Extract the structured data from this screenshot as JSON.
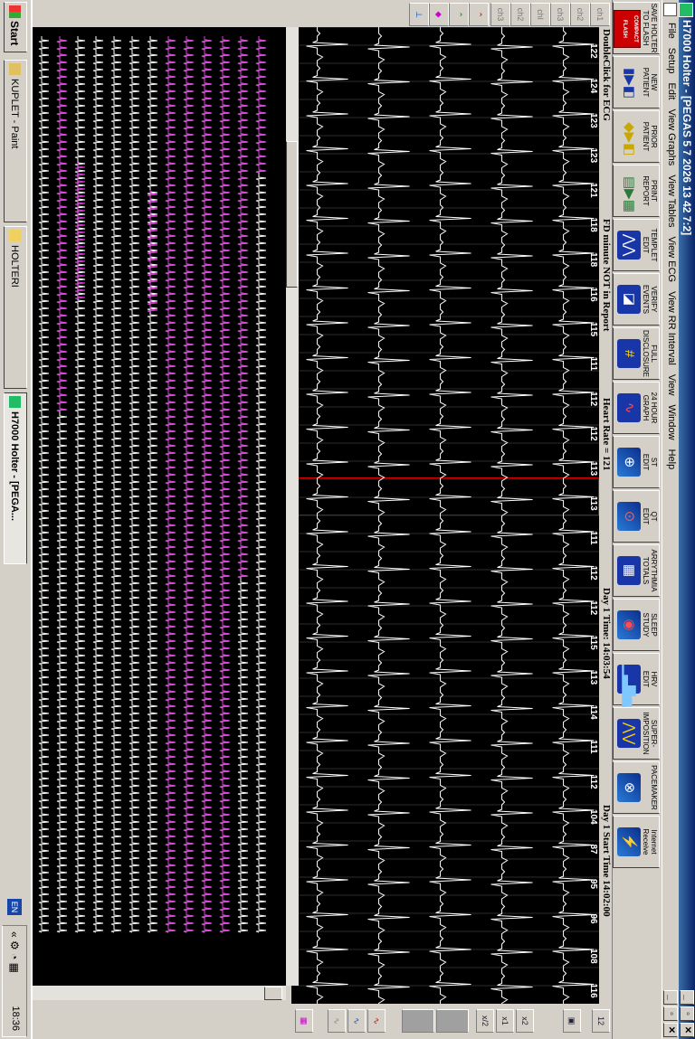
{
  "window": {
    "title": "H7000 Holter - [PEGAS 5 7 2026  13 42 7:2]",
    "min_label": "_",
    "max_label": "▫",
    "close_label": "✕"
  },
  "menu": [
    "File",
    "Setup",
    "Edit",
    "View Graphs",
    "View Tables",
    "View ECG",
    "View RR Interval",
    "View",
    "Window",
    "Help"
  ],
  "toolbar": [
    {
      "label": "SAVE HOLTER\nTO FLASH",
      "icon": "flash-card-icon"
    },
    {
      "label": "NEW\nPATIENT",
      "icon": "new-patient-icon"
    },
    {
      "label": "PRIOR\nPATIENT",
      "icon": "prior-patient-icon"
    },
    {
      "label": "PRINT\nREPORT",
      "icon": "printer-icon"
    },
    {
      "label": "TEMPLET\nEDIT",
      "icon": "template-edit-icon"
    },
    {
      "label": "VERIFY\nEVENTS",
      "icon": "verify-events-icon"
    },
    {
      "label": "FULL\nDISCLOSURE",
      "icon": "full-disclosure-icon"
    },
    {
      "label": "24 HOUR\nGRAPH",
      "icon": "graph-24h-icon"
    },
    {
      "label": "ST\nEDIT",
      "icon": "st-edit-icon"
    },
    {
      "label": "QT\nEDIT",
      "icon": "qt-edit-icon"
    },
    {
      "label": "ARRYTHMIA\nTOTALS",
      "icon": "arrhythmia-totals-icon"
    },
    {
      "label": "SLEEP\nSTUDY",
      "icon": "sleep-study-icon"
    },
    {
      "label": "HRV\nEDIT",
      "icon": "hrv-edit-icon"
    },
    {
      "label": "SUPER-\nIMPOSITION",
      "icon": "superimposition-icon"
    },
    {
      "label": "PACEMAKER",
      "icon": "pacemaker-icon"
    },
    {
      "label": "Internet\nReceive",
      "icon": "internet-receive-icon"
    }
  ],
  "flash_card": {
    "line1": "COMPACT",
    "line2": "FLASH"
  },
  "left_tools": [
    "ch1",
    "ch2",
    "ch3",
    "chl",
    "ch2",
    "ch3"
  ],
  "rate_header": {
    "double_click": "DoubleClick for ECG",
    "fd_minute": "FD minute NOT in Report",
    "heart_rate": "Heart Rate = 121",
    "day_time": "Day 1 Time: 14:03:54",
    "start_time": "Day 1 Start Time 14:02:00"
  },
  "hr_values": [
    "122",
    "124",
    "123",
    "123",
    "121",
    "118",
    "118",
    "116",
    "115",
    "111",
    "112",
    "112",
    "113",
    "113",
    "111",
    "112",
    "112",
    "115",
    "113",
    "114",
    "111",
    "112",
    "104",
    "87",
    "95",
    "96",
    "108",
    "116"
  ],
  "right_tools": [
    "12",
    "▣",
    "x2",
    "x1",
    "x/2"
  ],
  "taskbar": {
    "start": "Start",
    "tasks": [
      "KUPLET - Paint",
      "HOLTERI",
      "H7000 Holter - [PEGA..."
    ],
    "lang": "EN",
    "clock": "18:36"
  },
  "colors": {
    "magenta": "#e03ae0",
    "trace": "#ffffff",
    "grid_bg": "#000000",
    "titlebar": "#0a246a"
  }
}
